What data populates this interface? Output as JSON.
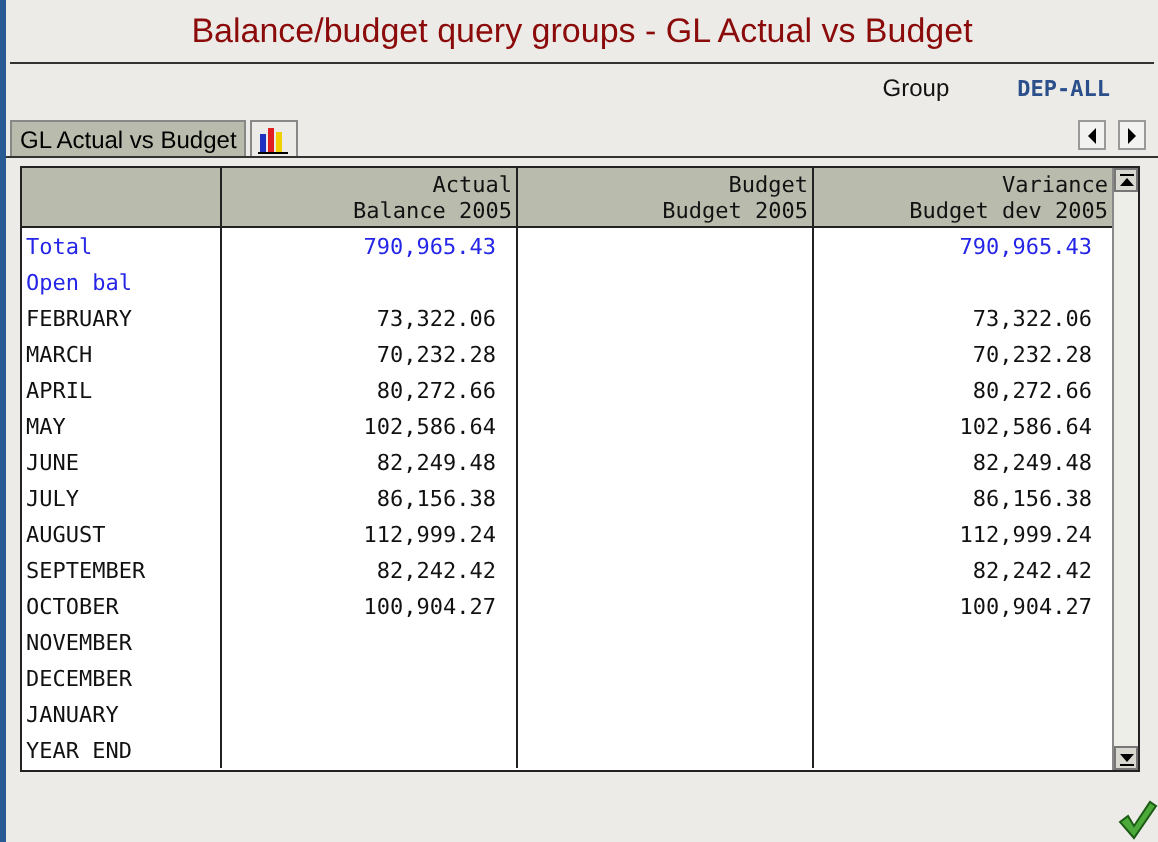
{
  "window": {
    "title": "Balance/budget query groups - GL Actual vs Budget"
  },
  "group": {
    "label": "Group",
    "value": "DEP-ALL"
  },
  "tabs": [
    {
      "kind": "text",
      "label": "GL Actual vs Budget",
      "selected": true
    },
    {
      "kind": "chart",
      "selected": false
    }
  ],
  "table": {
    "columns": [
      {
        "line1": "Actual",
        "line2": "Balance 2005"
      },
      {
        "line1": "Budget",
        "line2": "Budget 2005"
      },
      {
        "line1": "Variance",
        "line2": "Budget dev 2005"
      }
    ],
    "rows": [
      {
        "kind": "summary",
        "label": "Total",
        "actual": "790,965.43",
        "variance": "790,965.43"
      },
      {
        "kind": "summary",
        "label": "Open bal"
      },
      {
        "kind": "normal",
        "label": "FEBRUARY",
        "actual": "73,322.06",
        "variance": "73,322.06"
      },
      {
        "kind": "normal",
        "label": "MARCH",
        "actual": "70,232.28",
        "variance": "70,232.28"
      },
      {
        "kind": "normal",
        "label": "APRIL",
        "actual": "80,272.66",
        "variance": "80,272.66"
      },
      {
        "kind": "normal",
        "label": "MAY",
        "actual": "102,586.64",
        "variance": "102,586.64"
      },
      {
        "kind": "normal",
        "label": "JUNE",
        "actual": "82,249.48",
        "variance": "82,249.48"
      },
      {
        "kind": "normal",
        "label": "JULY",
        "actual": "86,156.38",
        "variance": "86,156.38"
      },
      {
        "kind": "normal",
        "label": "AUGUST",
        "actual": "112,999.24",
        "variance": "112,999.24"
      },
      {
        "kind": "normal",
        "label": "SEPTEMBER",
        "actual": "82,242.42",
        "variance": "82,242.42"
      },
      {
        "kind": "normal",
        "label": "OCTOBER",
        "actual": "100,904.27",
        "variance": "100,904.27"
      },
      {
        "kind": "normal",
        "label": "NOVEMBER"
      },
      {
        "kind": "normal",
        "label": "DECEMBER"
      },
      {
        "kind": "normal",
        "label": "JANUARY"
      },
      {
        "kind": "normal",
        "label": "YEAR END"
      }
    ]
  }
}
